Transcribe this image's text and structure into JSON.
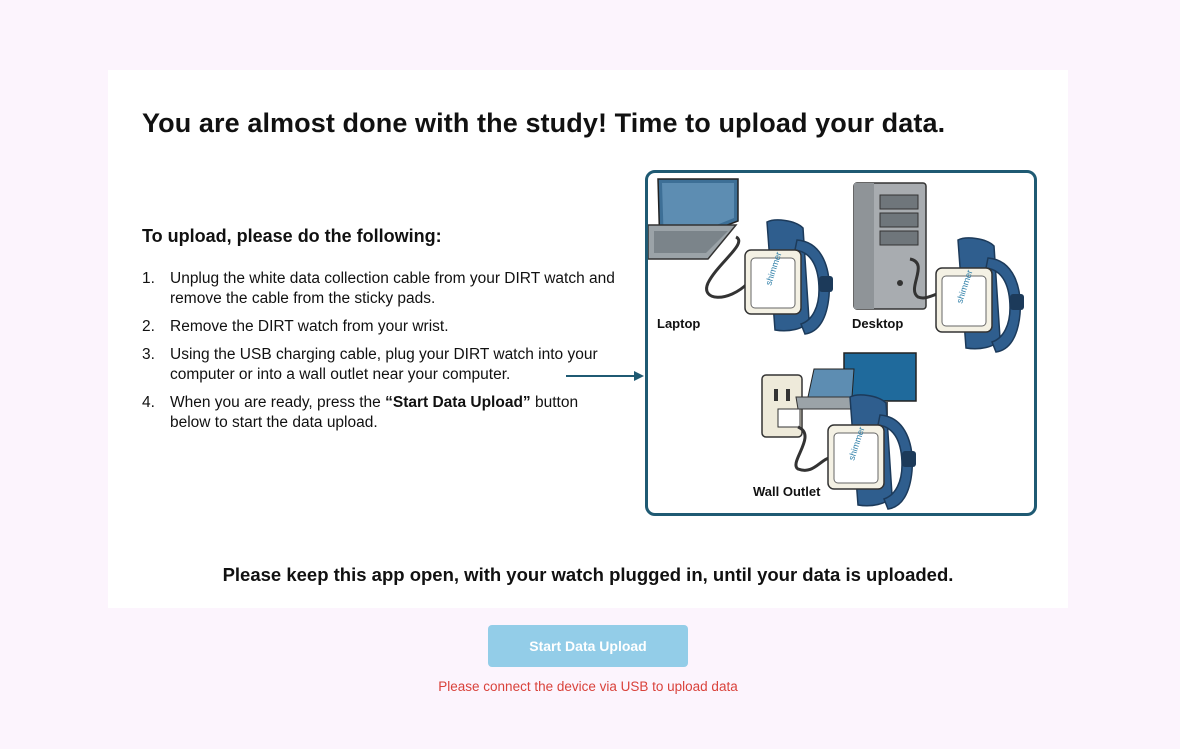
{
  "main": {
    "title": "You are almost done with the study! Time to upload your data.",
    "instructions_heading": "To upload, please do the following:",
    "steps": [
      {
        "num": "1.",
        "text": "Unplug the white data collection cable from your DIRT watch and remove the cable from the sticky pads."
      },
      {
        "num": "2.",
        "text": "Remove the DIRT watch from your wrist."
      },
      {
        "num": "3.",
        "text": "Using the USB charging cable, plug your DIRT watch into your computer or into a wall outlet near your computer."
      },
      {
        "num": "4.",
        "text_before": "When you are ready, press the ",
        "text_bold": "“Start Data Upload”",
        "text_after": " button below to start the data upload."
      }
    ],
    "illustration": {
      "labels": {
        "laptop": "Laptop",
        "desktop": "Desktop",
        "wall_outlet": "Wall Outlet"
      },
      "watch_brand": "shimmer"
    },
    "keep_open_notice": "Please keep this app open, with your watch plugged in, until your data is uploaded."
  },
  "upload_button": {
    "label": "Start Data Upload",
    "state": "disabled"
  },
  "error_message": "Please connect the device via USB to upload data",
  "colors": {
    "page_background": "#fcf4fd",
    "card_background": "#ffffff",
    "accent": "#1f5a73",
    "watch_band": "#2f5e8e",
    "button_disabled": "#93cde8",
    "error": "#d9423b"
  }
}
